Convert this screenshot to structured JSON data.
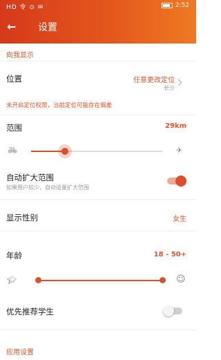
{
  "status_bar": {
    "left": "HD 令 ⊙ ✉",
    "time": "2:52",
    "battery_icon": "battery-icon"
  },
  "header": {
    "title": "设置",
    "back_icon": "back-arrow-icon"
  },
  "sections": {
    "discover": "向我显示",
    "app_settings": "应用设置"
  },
  "location": {
    "label": "位置",
    "value": "任意更改定位",
    "sub_value": "长沙",
    "warning": "未开启定位权限，当前定位可能存在偏差"
  },
  "distance": {
    "label": "范围",
    "value": "29km",
    "fill_fraction": 0.26,
    "min_icon": "bicycle-icon",
    "max_icon": "airplane-icon"
  },
  "auto_expand": {
    "label": "自动扩大范围",
    "desc": "如果用户较少，自动适量扩大范围",
    "enabled": true
  },
  "gender": {
    "label": "显示性别",
    "value": "女生"
  },
  "age": {
    "label": "年龄",
    "value": "18 - 50+",
    "min": 18,
    "max": 50,
    "min_icon": "graduation-cap-icon",
    "max_icon": "elder-face-icon"
  },
  "student_first": {
    "label": "优先推荐学生",
    "enabled": false
  },
  "colors": {
    "accent": "#e0552b",
    "header_start": "#d63a1a",
    "header_end": "#ee7a22"
  }
}
